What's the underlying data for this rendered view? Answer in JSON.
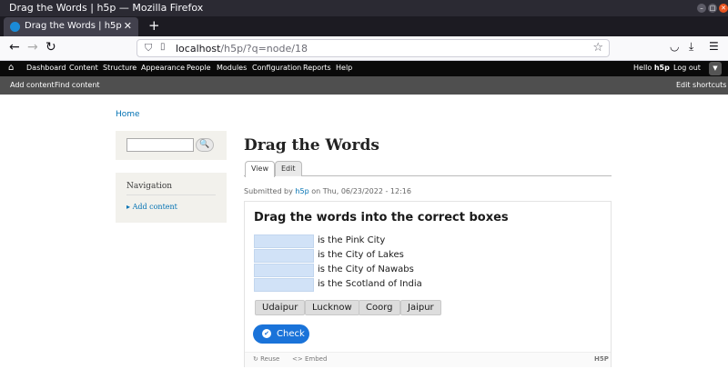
{
  "browser": {
    "window_title": "Drag the Words | h5p — Mozilla Firefox",
    "tab_title": "Drag the Words | h5p",
    "url_host": "localhost",
    "url_path": "/h5p/?q=node/18"
  },
  "admin_toolbar": {
    "items": [
      "Dashboard",
      "Content",
      "Structure",
      "Appearance",
      "People",
      "Modules",
      "Configuration",
      "Reports",
      "Help"
    ],
    "hello_prefix": "Hello ",
    "username": "h5p",
    "logout": "Log out"
  },
  "shortcuts": {
    "add_content": "Add content",
    "find_content": "Find content",
    "edit_shortcuts": "Edit shortcuts"
  },
  "breadcrumb": "Home",
  "sidebar": {
    "search_button": "🔍",
    "nav_title": "Navigation",
    "nav_link": "Add content"
  },
  "page": {
    "title": "Drag the Words",
    "tab_view": "View",
    "tab_edit": "Edit",
    "submitted_prefix": "Submitted by ",
    "submitted_user": "h5p",
    "submitted_suffix": " on Thu, 06/23/2022 - 12:16"
  },
  "h5p": {
    "task": "Drag the words into the correct boxes",
    "sentences": [
      "is the Pink City",
      "is the City of Lakes",
      "is the City of Nawabs",
      "is the Scotland of India"
    ],
    "words": [
      "Udaipur",
      "Lucknow",
      "Coorg",
      "Jaipur"
    ],
    "check": "Check",
    "reuse": "Reuse",
    "embed": "Embed",
    "brand": "H5P"
  }
}
